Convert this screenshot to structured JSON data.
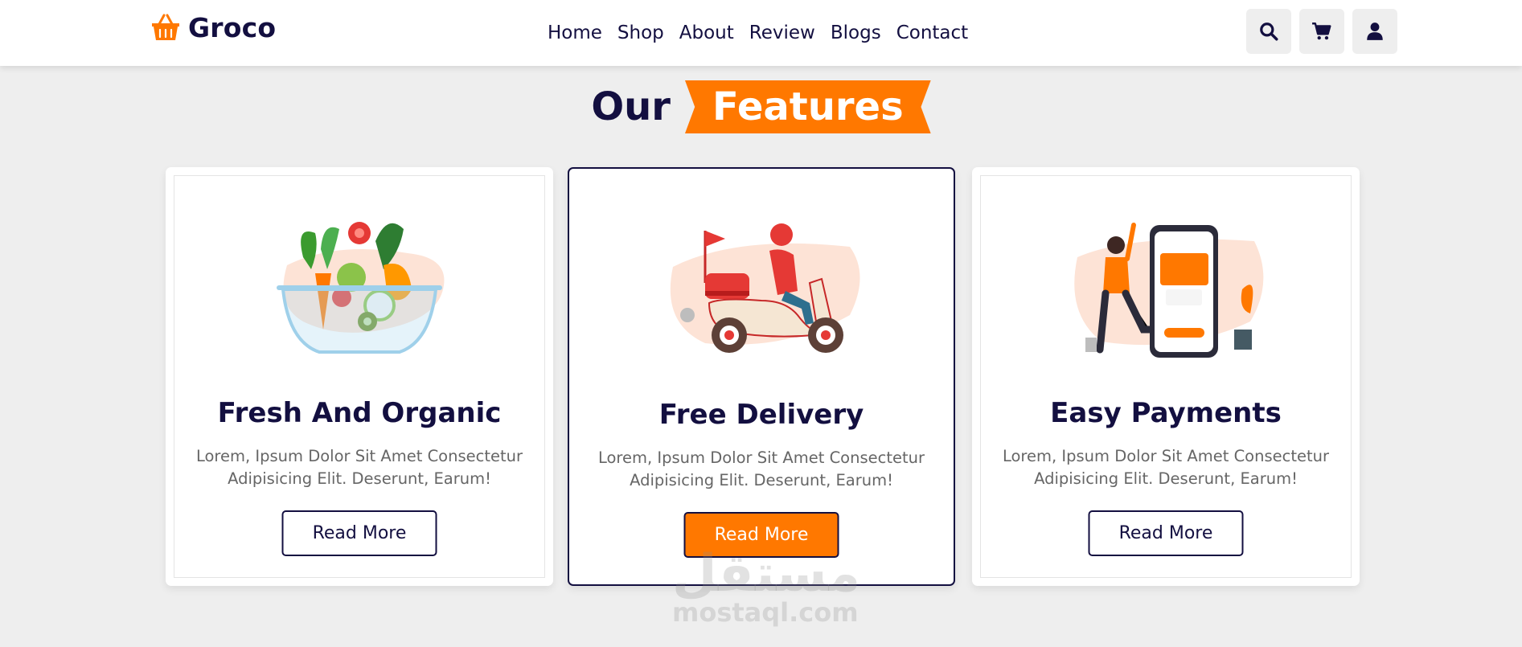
{
  "header": {
    "brand": "Groco",
    "nav": [
      "Home",
      "Shop",
      "About",
      "Review",
      "Blogs",
      "Contact"
    ],
    "icons": [
      "search-icon",
      "cart-icon",
      "user-icon"
    ]
  },
  "section": {
    "heading_plain": "Our",
    "heading_highlight": "Features"
  },
  "cards": [
    {
      "illustration": "salad-bowl-illustration",
      "title": "Fresh And Organic",
      "description": "Lorem, Ipsum Dolor Sit Amet Consectetur Adipisicing Elit. Deserunt, Earum!",
      "button": "Read More",
      "active": false
    },
    {
      "illustration": "delivery-scooter-illustration",
      "title": "Free Delivery",
      "description": "Lorem, Ipsum Dolor Sit Amet Consectetur Adipisicing Elit. Deserunt, Earum!",
      "button": "Read More",
      "active": true
    },
    {
      "illustration": "mobile-payment-illustration",
      "title": "Easy Payments",
      "description": "Lorem, Ipsum Dolor Sit Amet Consectetur Adipisicing Elit. Deserunt, Earum!",
      "button": "Read More",
      "active": false
    }
  ],
  "watermark": {
    "arabic": "مستقل",
    "latin": "mostaql.com"
  },
  "colors": {
    "accent": "#ff7800",
    "dark": "#130f40",
    "background": "#eeeeee"
  }
}
